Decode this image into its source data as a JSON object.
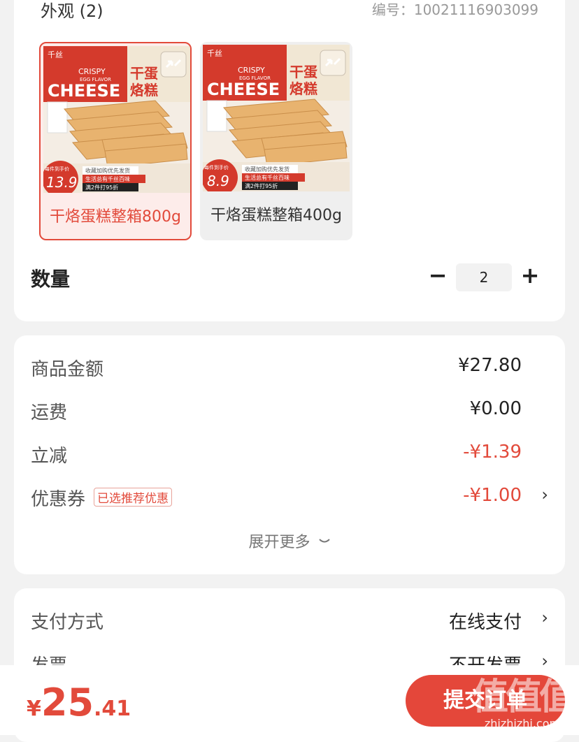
{
  "variants": {
    "title": "外观 (2)",
    "sku": "编号：10021116903099",
    "items": [
      {
        "label": "干烙蛋糕整箱800g",
        "selected": true,
        "badge_price": "13.9",
        "box_text": "CHEESE",
        "box_sub": "CRISPY",
        "box_sub2": "EGG FLAVOR",
        "box_cn1": "干蛋",
        "box_cn2": "烙糕",
        "promo1": "收藏加购优先发货",
        "promo2": "生活总有千丝百味",
        "promo3": "满2件打95折",
        "badge_tag": "每件到手价",
        "brand": "千丝"
      },
      {
        "label": "干烙蛋糕整箱400g",
        "selected": false,
        "badge_price": "8.9",
        "box_text": "CHEESE",
        "box_sub": "CRISPY",
        "box_sub2": "EGG FLAVOR",
        "box_cn1": "干蛋",
        "box_cn2": "烙糕",
        "promo1": "收藏加购优先发货",
        "promo2": "生活总有千丝百味",
        "promo3": "满2件打95折",
        "badge_tag": "每件到手价",
        "brand": "千丝"
      }
    ]
  },
  "quantity": {
    "label": "数量",
    "value": "2",
    "minus": "−",
    "plus": "+"
  },
  "summary": {
    "goods_label": "商品金额",
    "goods_value": "¥27.80",
    "shipping_label": "运费",
    "shipping_value": "¥0.00",
    "discount_label": "立减",
    "discount_value": "-¥1.39",
    "coupon_label": "优惠券",
    "coupon_tag": "已选推荐优惠",
    "coupon_value": "-¥1.00",
    "expand_label": "展开更多"
  },
  "payment": {
    "method_label": "支付方式",
    "method_value": "在线支付",
    "invoice_label": "发票",
    "invoice_value": "不开发票"
  },
  "footer": {
    "currency": "¥",
    "total_int": "25",
    "total_dec": ".41",
    "submit_label": "提交订单",
    "watermark": "值",
    "watermark_site": "zhizhizhi.com"
  },
  "colors": {
    "accent": "#e24a3b",
    "page_bg": "#f2f2f2",
    "card_bg": "#ffffff"
  },
  "icons": [
    "minus-icon",
    "plus-icon",
    "chevron-right-icon",
    "chevron-down-icon",
    "zoom-icon"
  ]
}
